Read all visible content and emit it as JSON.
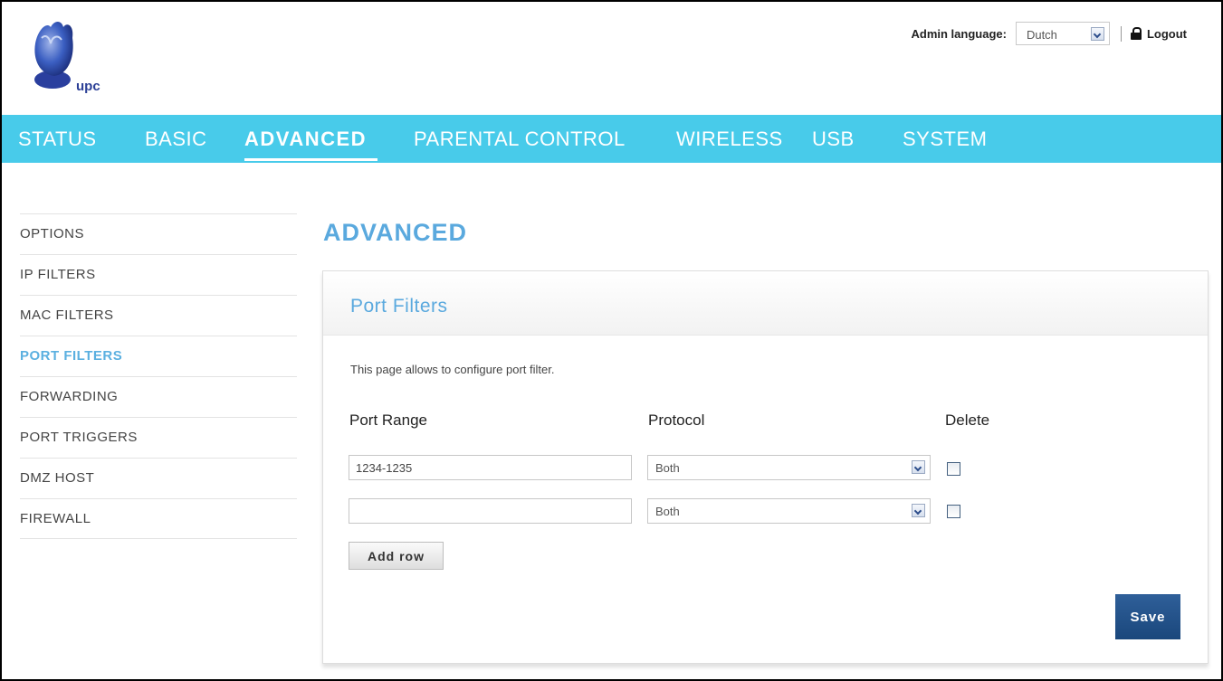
{
  "header": {
    "logo_text": "upc",
    "admin_language_label": "Admin language:",
    "admin_language_value": "Dutch",
    "logout_label": "Logout"
  },
  "nav": {
    "items": [
      "STATUS",
      "BASIC",
      "ADVANCED",
      "PARENTAL CONTROL",
      "WIRELESS",
      "USB",
      "SYSTEM"
    ],
    "active": "ADVANCED"
  },
  "sidebar": {
    "items": [
      "OPTIONS",
      "IP FILTERS",
      "MAC FILTERS",
      "PORT FILTERS",
      "FORWARDING",
      "PORT TRIGGERS",
      "DMZ HOST",
      "FIREWALL"
    ],
    "active": "PORT FILTERS"
  },
  "main": {
    "title": "ADVANCED",
    "panel_title": "Port Filters",
    "description": "This page allows to configure port filter.",
    "columns": {
      "port_range": "Port Range",
      "protocol": "Protocol",
      "delete": "Delete"
    },
    "rows": [
      {
        "port_range": "1234-1235",
        "protocol": "Both",
        "delete": false
      },
      {
        "port_range": "",
        "protocol": "Both",
        "delete": false
      }
    ],
    "add_row_label": "Add row",
    "save_label": "Save"
  },
  "colors": {
    "nav_bg": "#48cbea",
    "accent": "#5aa9de",
    "save_button": "#1f4f87"
  }
}
